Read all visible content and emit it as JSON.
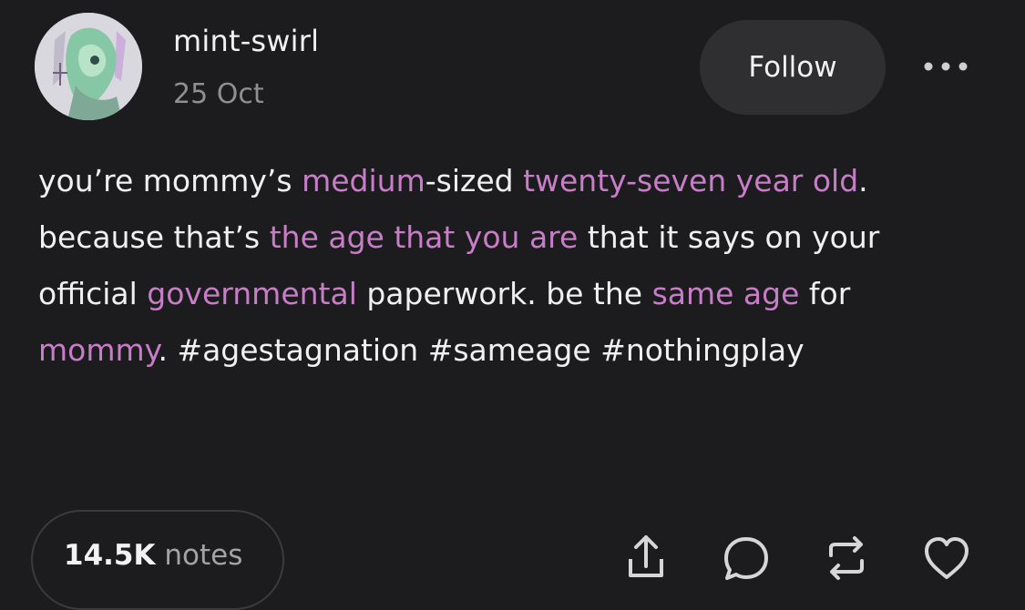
{
  "post": {
    "username": "mint-swirl",
    "date": "25 Oct",
    "follow_label": "Follow",
    "body_segments": [
      {
        "text": "you’re mommy’s ",
        "highlight": false
      },
      {
        "text": "medium",
        "highlight": true
      },
      {
        "text": "-sized ",
        "highlight": false
      },
      {
        "text": "twenty-seven year old",
        "highlight": true
      },
      {
        "text": ". because that’s ",
        "highlight": false
      },
      {
        "text": "the age that you are",
        "highlight": true
      },
      {
        "text": " that it says on your official ",
        "highlight": false
      },
      {
        "text": "governmental",
        "highlight": true
      },
      {
        "text": " paperwork. be the ",
        "highlight": false
      },
      {
        "text": "same age",
        "highlight": true
      },
      {
        "text": " for ",
        "highlight": false
      },
      {
        "text": "mommy",
        "highlight": true
      },
      {
        "text": ". #agestagnation #sameage #nothingplay",
        "highlight": false
      }
    ],
    "notes_count": "14.5K",
    "notes_label": "notes"
  },
  "colors": {
    "background": "#1c1b1d",
    "text": "#f0f0f0",
    "highlight": "#c77dc7",
    "muted": "#8f8e93",
    "button_bg": "#2f2e31"
  },
  "icons": {
    "more": "more-horizontal-icon",
    "share": "share-icon",
    "reply": "reply-bubble-icon",
    "reblog": "reblog-icon",
    "like": "heart-icon"
  }
}
